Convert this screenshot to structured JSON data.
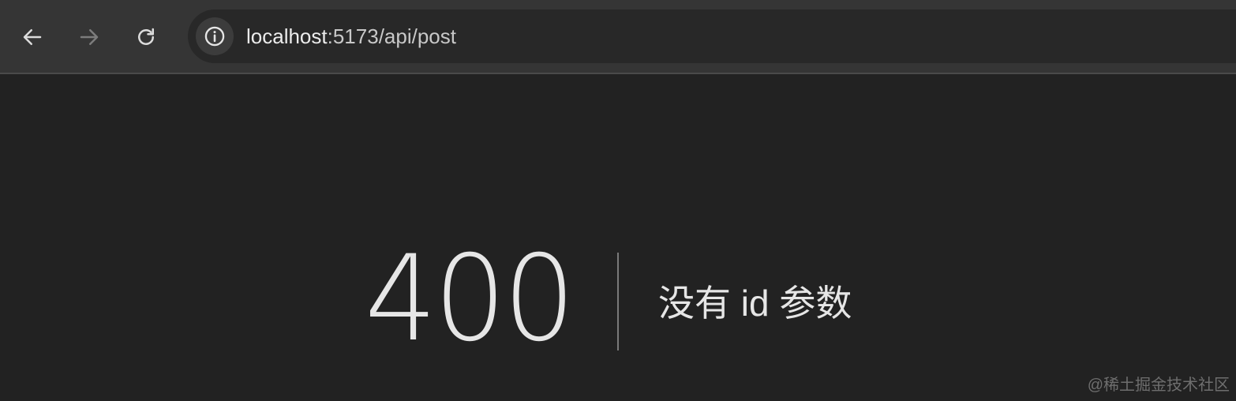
{
  "browser": {
    "url": {
      "host": "localhost",
      "rest": ":5173/api/post"
    },
    "icons": {
      "back": "arrow-left-icon",
      "forward": "arrow-right-icon",
      "reload": "reload-icon",
      "site_info": "info-circle-icon"
    },
    "colors": {
      "toolbar": "#353535",
      "omnibox": "#282828",
      "page_background": "#222222",
      "text": "#e6e6e6"
    }
  },
  "page": {
    "status_code": "400",
    "message": "没有 id 参数"
  },
  "watermark": "@稀土掘金技术社区"
}
